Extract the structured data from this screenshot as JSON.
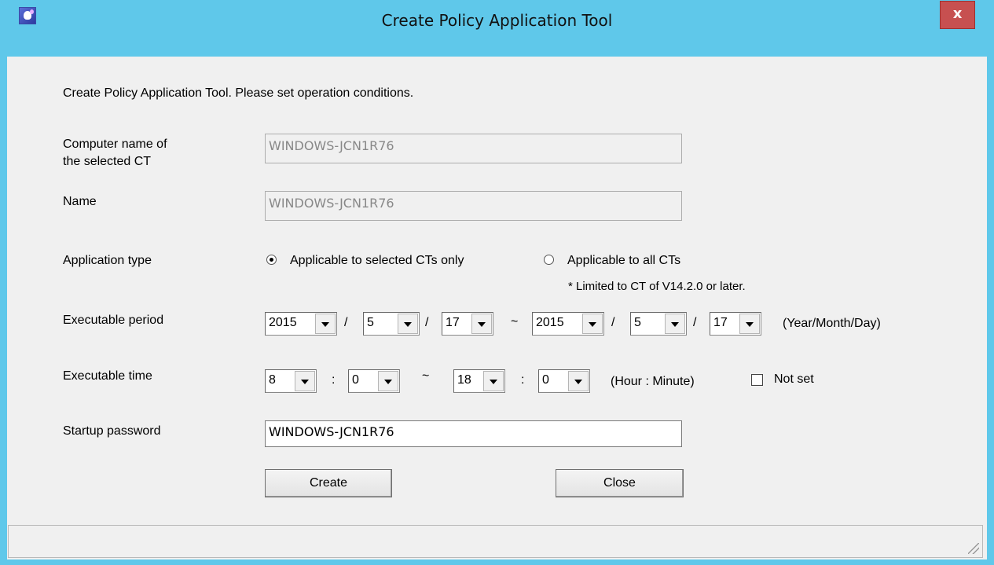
{
  "window": {
    "title": "Create Policy Application Tool",
    "close_label": "x"
  },
  "instructions": "Create Policy Application Tool. Please set operation conditions.",
  "computer_name": {
    "label_line1": "Computer name of",
    "label_line2": "the selected CT",
    "value": "WINDOWS-JCN1R76"
  },
  "name": {
    "label": "Name",
    "value": "WINDOWS-JCN1R76"
  },
  "application_type": {
    "label": "Application type",
    "option_selected": "Applicable to selected CTs only",
    "option_all": "Applicable to all CTs",
    "note": "* Limited to CT of V14.2.0 or later.",
    "selected": "selected"
  },
  "executable_period": {
    "label": "Executable period",
    "start": {
      "year": "2015",
      "month": "5",
      "day": "17"
    },
    "end": {
      "year": "2015",
      "month": "5",
      "day": "17"
    },
    "date_sep": "/",
    "range_sep": "~",
    "format_hint": "(Year/Month/Day)"
  },
  "executable_time": {
    "label": "Executable time",
    "start": {
      "hour": "8",
      "minute": "0"
    },
    "end": {
      "hour": "18",
      "minute": "0"
    },
    "time_sep": ":",
    "range_sep": "~",
    "format_hint": "(Hour : Minute)",
    "not_set_label": "Not set",
    "not_set_checked": false
  },
  "startup_password": {
    "label": "Startup password",
    "value": "WINDOWS-JCN1R76"
  },
  "buttons": {
    "create": "Create",
    "close": "Close"
  },
  "colors": {
    "title_bar": "#5fc8ea",
    "close_button": "#c75050",
    "client_bg": "#f0f0f0"
  }
}
